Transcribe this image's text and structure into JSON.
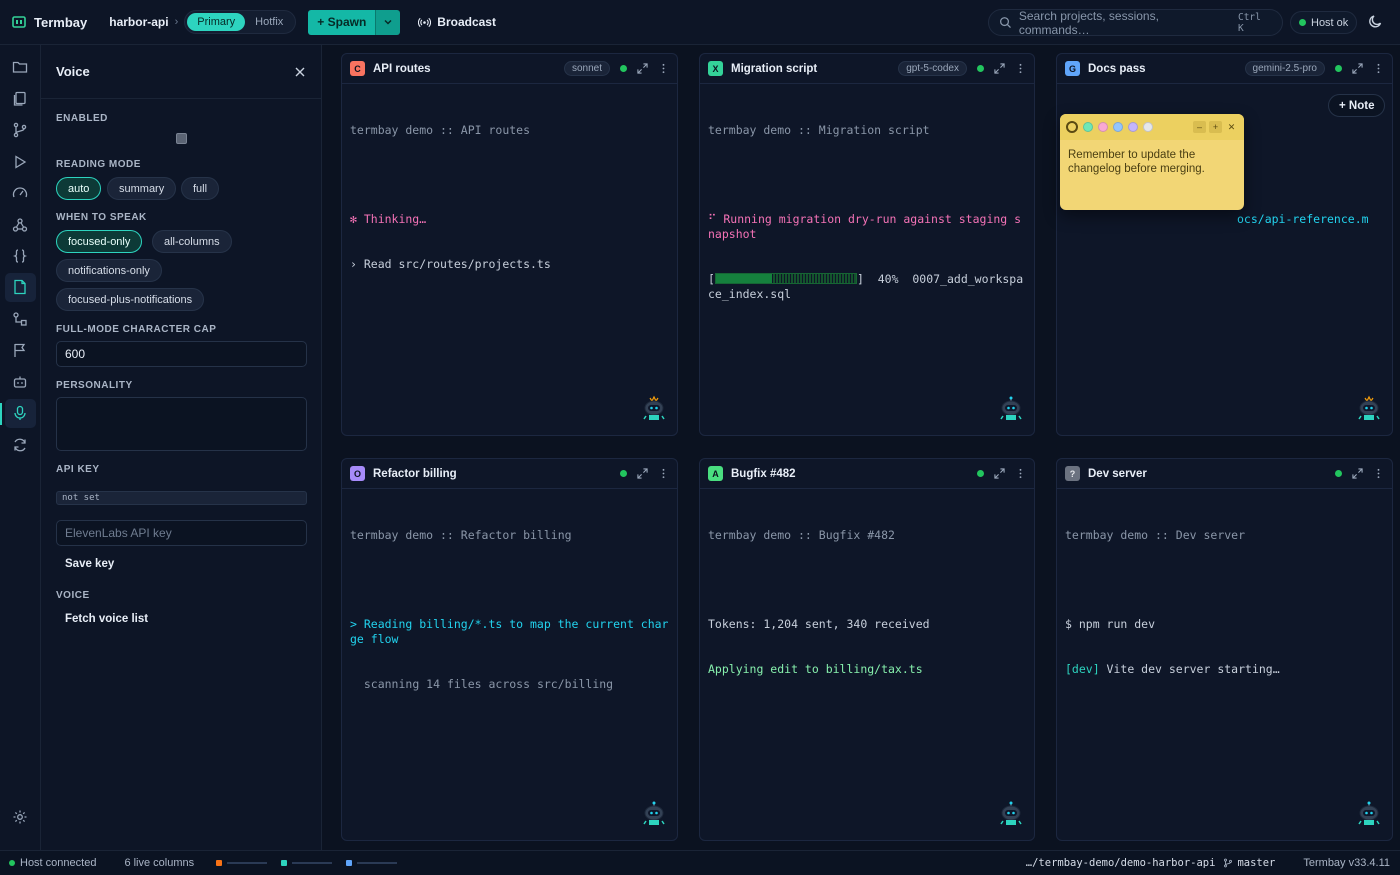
{
  "app": {
    "name": "Termbay",
    "project": "harbor-api",
    "workspaces": [
      "Primary",
      "Hotfix"
    ],
    "active_workspace": "Primary",
    "spawn_label": "+ Spawn",
    "broadcast_label": "Broadcast",
    "search_placeholder": "Search projects, sessions, commands…",
    "search_shortcut": "Ctrl K",
    "host_status": "Host ok"
  },
  "rail": {
    "icons": [
      "folder-icon",
      "files-icon",
      "git-branch-icon",
      "play-icon",
      "gauge-icon",
      "webhook-icon",
      "braces-icon",
      "notes-icon",
      "diagram-icon",
      "flag-icon",
      "robot-icon",
      "microphone-icon",
      "refresh-icon"
    ],
    "active": "microphone-icon"
  },
  "voice": {
    "title": "Voice",
    "enabled_label": "ENABLED",
    "enabled": false,
    "reading_mode_label": "READING MODE",
    "reading_modes": [
      "auto",
      "summary",
      "full"
    ],
    "reading_mode_selected": "auto",
    "when_label": "WHEN TO SPEAK",
    "when_options": [
      "focused-only",
      "all-columns",
      "notifications-only",
      "focused-plus-notifications"
    ],
    "when_selected": "focused-only",
    "cap_label": "FULL-MODE CHARACTER CAP",
    "cap_value": "600",
    "personality_label": "PERSONALITY",
    "personality_value": "",
    "api_key_label": "API KEY",
    "api_key_status": "not set",
    "api_key_placeholder": "ElevenLabs API key",
    "save_key_label": "Save key",
    "voice_label": "VOICE",
    "fetch_label": "Fetch voice list"
  },
  "columns": [
    {
      "badge": "C",
      "badge_color": "#f97360",
      "name": "API routes",
      "model": "sonnet",
      "title_line": "termbay demo :: API routes",
      "thinking": "✻ Thinking…",
      "read": "› Read src/routes/projects.ts"
    },
    {
      "badge": "X",
      "badge_color": "#34d399",
      "name": "Migration script",
      "model": "gpt-5-codex",
      "title_line": "termbay demo :: Migration script",
      "running": "⠋ Running migration dry-run against staging snapshot",
      "progress": 0.4,
      "progress_text": "40%",
      "progress_file": "0007_add_workspace_index.sql"
    },
    {
      "badge": "G",
      "badge_color": "#60a5fa",
      "name": "Docs pass",
      "model": "gemini-2.5-pro",
      "title_line": "termbay demo :: Docs pass",
      "partial_line": "ocs/api-reference.m"
    },
    {
      "badge": "O",
      "badge_color": "#a78bfa",
      "name": "Refactor billing",
      "model": "",
      "title_line": "termbay demo :: Refactor billing",
      "reading": "> Reading billing/*.ts to map the current charge flow",
      "scanning": "  scanning 14 files across src/billing"
    },
    {
      "badge": "A",
      "badge_color": "#4ade80",
      "name": "Bugfix #482",
      "model": "",
      "title_line": "termbay demo :: Bugfix #482",
      "tokens": "Tokens: 1,204 sent, 340 received",
      "applying": "Applying edit to billing/tax.ts"
    },
    {
      "badge": "?",
      "badge_color": "#6b7280",
      "name": "Dev server",
      "model": "",
      "title_line": "termbay demo :: Dev server",
      "cmd": "$ npm run dev",
      "dev_tag": "[dev]",
      "dev_text": " Vite dev server starting…"
    }
  ],
  "note": {
    "text": "Remember to update the changelog before merging.",
    "colors": [
      "#f2d675",
      "#6ee7b7",
      "#f9a8d4",
      "#93c5fd",
      "#c4b5fd",
      "#e5e7eb"
    ],
    "add_label": "+ Note"
  },
  "status": {
    "host": "Host connected",
    "live": "6 live columns",
    "path": "…/termbay-demo/demo-harbor-api",
    "branch": "master",
    "version": "Termbay v33.4.11",
    "minis": [
      "#f97316",
      "#2dd4bf",
      "#60a5fa"
    ]
  }
}
